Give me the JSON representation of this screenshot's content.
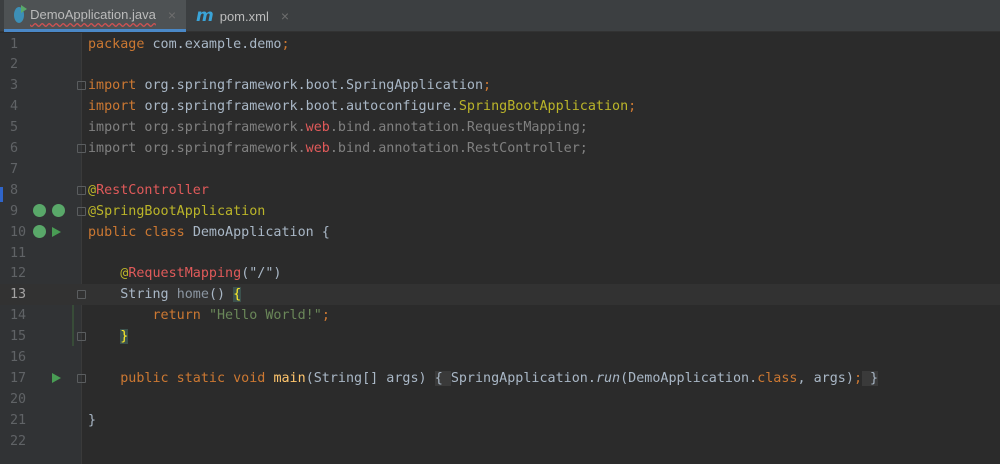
{
  "tabs": [
    {
      "label": "DemoApplication.java",
      "icon": "spring-java-class-icon",
      "active": true
    },
    {
      "label": "pom.xml",
      "icon": "maven-icon",
      "active": false
    }
  ],
  "tab_close": "×",
  "maven_glyph": "m",
  "current_line": 13,
  "lines": [
    {
      "n": "1",
      "row": 0,
      "tokens": [
        [
          "package ",
          "kw"
        ],
        [
          "com.example.demo",
          ""
        ],
        [
          ";",
          "kw"
        ]
      ]
    },
    {
      "n": "2",
      "row": 1,
      "tokens": []
    },
    {
      "n": "3",
      "row": 2,
      "fold": true,
      "tokens": [
        [
          "import ",
          "kw"
        ],
        [
          "org.springframework.boot.SpringApplication",
          ""
        ],
        [
          ";",
          "kw"
        ]
      ]
    },
    {
      "n": "4",
      "row": 3,
      "tokens": [
        [
          "import ",
          "kw"
        ],
        [
          "org.springframework.boot.autoconfigure.",
          ""
        ],
        [
          "SpringBootApplication",
          "ann"
        ],
        [
          ";",
          "kw"
        ]
      ]
    },
    {
      "n": "5",
      "row": 4,
      "tokens": [
        [
          "import org.springframework.",
          "gray"
        ],
        [
          "web",
          "red"
        ],
        [
          ".bind.annotation.RequestMapping;",
          "gray"
        ]
      ]
    },
    {
      "n": "6",
      "row": 5,
      "fold": true,
      "tokens": [
        [
          "import org.springframework.",
          "gray"
        ],
        [
          "web",
          "red"
        ],
        [
          ".bind.annotation.RestController;",
          "gray"
        ]
      ]
    },
    {
      "n": "7",
      "row": 6,
      "tokens": []
    },
    {
      "n": "8",
      "row": 7,
      "fold": true,
      "tokens": [
        [
          "@",
          "ann"
        ],
        [
          "RestController",
          "red"
        ]
      ]
    },
    {
      "n": "9",
      "row": 8,
      "fold": true,
      "icons": [
        "spring-bean-search-icon",
        "spring-bean-check-icon"
      ],
      "tokens": [
        [
          "@SpringBootApplication",
          "ann"
        ]
      ]
    },
    {
      "n": "10",
      "row": 9,
      "icons": [
        "spring-bean-icon",
        "run-icon"
      ],
      "tokens": [
        [
          "public class ",
          "kw"
        ],
        [
          "DemoApplication {",
          ""
        ]
      ]
    },
    {
      "n": "11",
      "row": 10,
      "tokens": []
    },
    {
      "n": "12",
      "row": 11,
      "tokens": [
        [
          "    @",
          "ann"
        ],
        [
          "RequestMapping",
          "red"
        ],
        [
          "(\"/\")",
          ""
        ]
      ]
    },
    {
      "n": "13",
      "row": 12,
      "fold": true,
      "tokens": [
        [
          "    String ",
          ""
        ],
        [
          "home",
          "mut"
        ],
        [
          "() ",
          ""
        ],
        [
          "{",
          "brace"
        ]
      ]
    },
    {
      "n": "14",
      "row": 13,
      "tokens": [
        [
          "        return ",
          "kw"
        ],
        [
          "\"Hello World!\"",
          "str"
        ],
        [
          ";",
          "kw"
        ]
      ]
    },
    {
      "n": "15",
      "row": 14,
      "fold": true,
      "tokens": [
        [
          "    ",
          ""
        ],
        [
          "}",
          "brace"
        ]
      ]
    },
    {
      "n": "16",
      "row": 15,
      "tokens": []
    },
    {
      "n": "17",
      "row": 16,
      "fold": true,
      "icons": [
        "",
        "run-icon"
      ],
      "tokens": [
        [
          "    public static void ",
          "kw"
        ],
        [
          "main",
          "fn"
        ],
        [
          "(String[] args) ",
          ""
        ],
        [
          "{ ",
          "fbox"
        ],
        [
          "SpringApplication.",
          ""
        ],
        [
          "run",
          "it"
        ],
        [
          "(DemoApplication.",
          ""
        ],
        [
          "class",
          "kw"
        ],
        [
          ", args)",
          ""
        ],
        [
          ";",
          "kw"
        ],
        [
          " }",
          "fbox"
        ]
      ]
    },
    {
      "n": "20",
      "row": 17,
      "tokens": []
    },
    {
      "n": "21",
      "row": 18,
      "tokens": [
        [
          "}",
          ""
        ]
      ]
    },
    {
      "n": "22",
      "row": 19,
      "tokens": []
    }
  ]
}
